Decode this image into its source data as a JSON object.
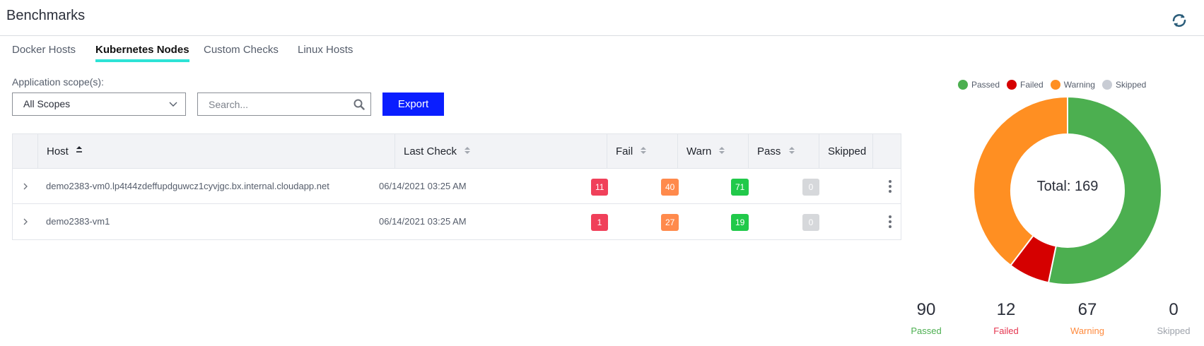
{
  "app": {
    "title": "Benchmarks"
  },
  "tabs": [
    {
      "label": "Docker Hosts",
      "active": false
    },
    {
      "label": "Kubernetes Nodes",
      "active": true
    },
    {
      "label": "Custom Checks",
      "active": false
    },
    {
      "label": "Linux Hosts",
      "active": false
    }
  ],
  "filters": {
    "scope_label": "Application scope(s):",
    "scope_value": "All Scopes",
    "search_placeholder": "Search...",
    "search_value": "",
    "export_label": "Export"
  },
  "table": {
    "columns": [
      "Host",
      "Last Check",
      "Fail",
      "Warn",
      "Pass",
      "Skipped"
    ],
    "sorted_column": "Host",
    "rows": [
      {
        "host": "demo2383-vm0.lp4t44zdeffupdguwcz1cyvjgc.bx.internal.cloudapp.net",
        "last_check": "06/14/2021 03:25 AM",
        "fail": "11",
        "warn": "40",
        "pass": "71",
        "skipped": "0"
      },
      {
        "host": "demo2383-vm1",
        "last_check": "06/14/2021 03:25 AM",
        "fail": "1",
        "warn": "27",
        "pass": "19",
        "skipped": "0"
      }
    ]
  },
  "chart_data": {
    "type": "pie",
    "categories": [
      "Passed",
      "Failed",
      "Warning",
      "Skipped"
    ],
    "values": [
      90,
      12,
      67,
      0
    ],
    "colors": [
      "#4caf50",
      "#d50000",
      "#ff8f22",
      "#c8ccd4"
    ],
    "center_label": "Total: 169",
    "legend_position": "top"
  },
  "summary": [
    {
      "value": "90",
      "label": "Passed",
      "color": "#4caf50"
    },
    {
      "value": "12",
      "label": "Failed",
      "color": "#e5354f"
    },
    {
      "value": "67",
      "label": "Warning",
      "color": "#ff8a3d"
    },
    {
      "value": "0",
      "label": "Skipped",
      "color": "#9ea3ab"
    }
  ],
  "colors": {
    "fail_badge": "#f0405a",
    "warn_badge": "#ff8a4c",
    "pass_badge": "#21c94a",
    "skipped_badge": "#d6d8db",
    "export_button": "#0a1eff",
    "active_tab_underline": "#2de3d6"
  },
  "icons": {
    "refresh": "refresh-icon",
    "dropdown": "chevron-down-icon",
    "search": "search-icon",
    "expand": "chevron-right-icon",
    "sort": "sort-icon",
    "row_menu": "kebab-icon"
  }
}
